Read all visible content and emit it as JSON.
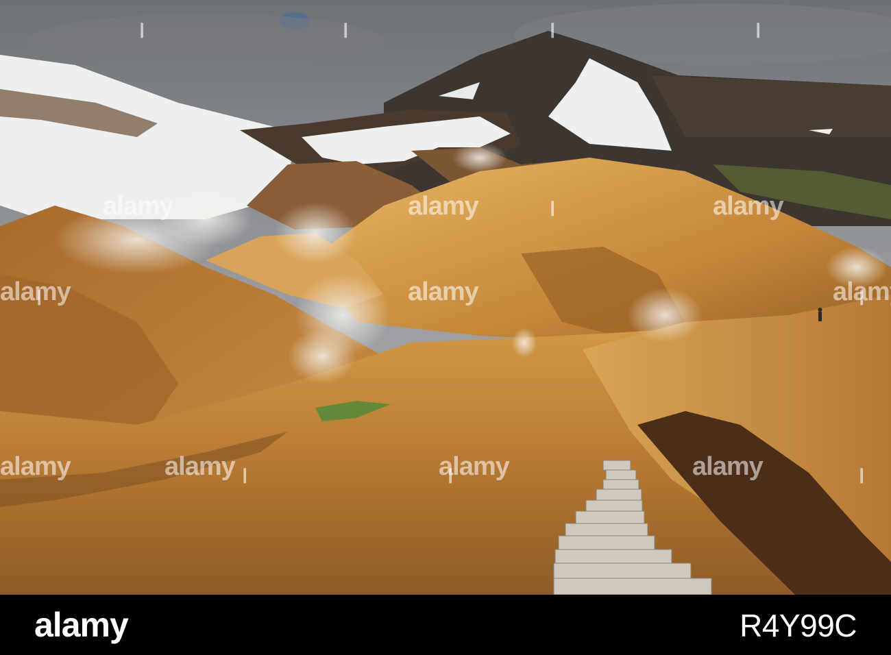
{
  "footer": {
    "brand": "alamy",
    "image_id": "R4Y99C"
  },
  "watermark": {
    "text": "alamy"
  },
  "colors": {
    "sky": "#8f9196",
    "snow": "#eef0f0",
    "rhyolite": "#c98a3c",
    "dark_rock": "#3b342e",
    "footer_bg": "#000000"
  }
}
